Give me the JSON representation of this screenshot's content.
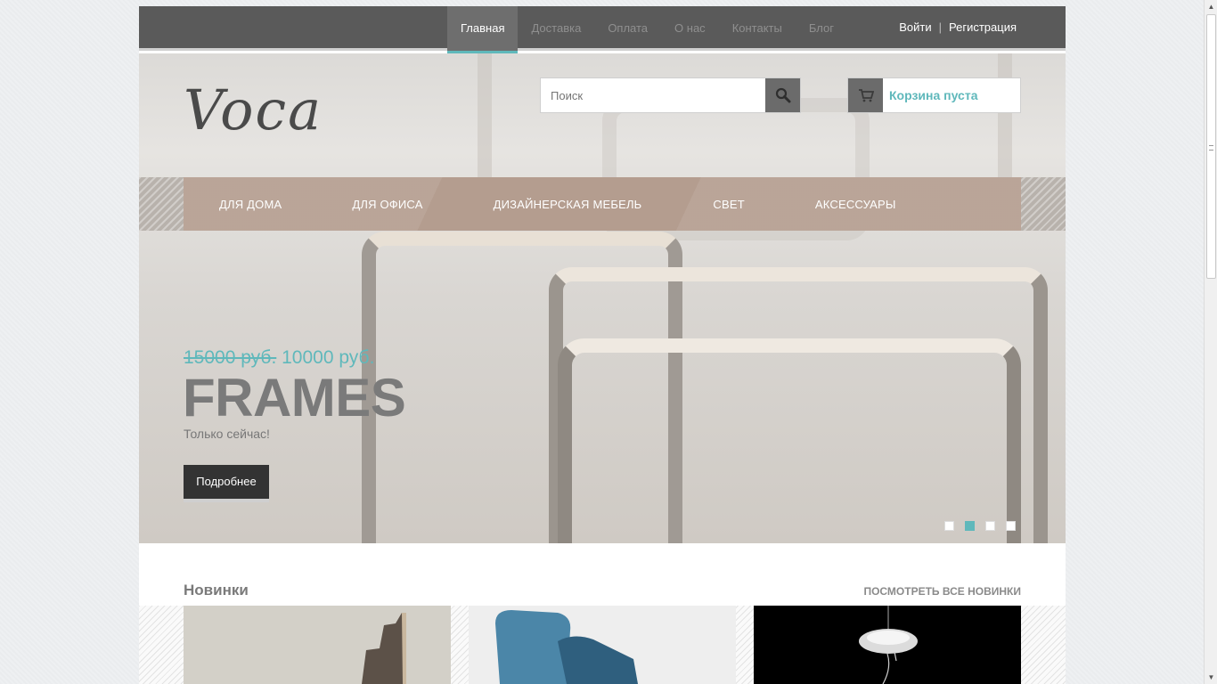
{
  "topnav": {
    "items": [
      {
        "label": "Главная",
        "active": true
      },
      {
        "label": "Доставка",
        "active": false
      },
      {
        "label": "Оплата",
        "active": false
      },
      {
        "label": "О нас",
        "active": false
      },
      {
        "label": "Контакты",
        "active": false
      },
      {
        "label": "Блог",
        "active": false
      }
    ],
    "login": "Войти",
    "separator": "|",
    "register": "Регистрация"
  },
  "brand": {
    "logo_text": "Voca"
  },
  "search": {
    "placeholder": "Поиск",
    "icon": "search-icon"
  },
  "cart": {
    "label": "Корзина пуста",
    "icon": "cart-icon"
  },
  "categories": [
    {
      "label": "ДЛЯ ДОМА"
    },
    {
      "label": "ДЛЯ ОФИСА"
    },
    {
      "label": "ДИЗАЙНЕРСКАЯ МЕБЕЛЬ"
    },
    {
      "label": "СВЕТ"
    },
    {
      "label": "АКСЕССУАРЫ"
    }
  ],
  "slide": {
    "old_price": "15000 руб.",
    "new_price": "10000 руб.",
    "title": "FRAMES",
    "subtitle": "Только сейчас!",
    "button": "Подробнее",
    "dots_total": 4,
    "active_dot": 2
  },
  "new_items": {
    "title": "Новинки",
    "view_all": "ПОСМОТРЕТЬ ВСЕ НОВИНКИ"
  },
  "colors": {
    "accent": "#5fb8bb",
    "topbar": "#5a5a5a",
    "category_bar": "#b49d8f",
    "button_dark": "#333333"
  }
}
